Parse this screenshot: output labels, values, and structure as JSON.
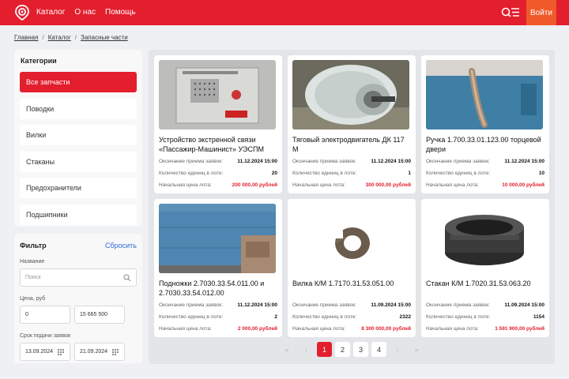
{
  "header": {
    "nav": [
      "Каталог",
      "О нас",
      "Помощь"
    ],
    "login_label": "Войти"
  },
  "breadcrumb": [
    "Главная",
    "Каталог",
    "Запасные части"
  ],
  "categories": {
    "title": "Категории",
    "items": [
      "Все запчасти",
      "Поводки",
      "Вилки",
      "Стаканы",
      "Предохранители",
      "Подшипники"
    ]
  },
  "filter": {
    "title": "Фильтр",
    "reset": "Сбросить",
    "name_label": "Название",
    "search_placeholder": "Поиск",
    "price_label": "Цена, руб",
    "price_from": "0",
    "price_to": "15 665 500",
    "deadline_label": "Срок подачи заявок",
    "date_from": "13.09.2024",
    "date_to": "21.09.2024"
  },
  "labels": {
    "deadline": "Окончание приема заявок:",
    "quantity": "Количество единиц в лоте:",
    "price": "Начальная цена лота:"
  },
  "products": [
    {
      "title": "Устройство экстренной связи «Пассажир-Машинист» УЭСПМ",
      "deadline": "11.12.2024 15:00",
      "quantity": "20",
      "price": "200 000,00 рублей"
    },
    {
      "title": "Тяговый электродвигатель ДК 117 М",
      "deadline": "11.12.2024 15:00",
      "quantity": "1",
      "price": "300 000,00 рублей"
    },
    {
      "title": "Ручка 1.700.33.01.123.00 торцевой двери",
      "deadline": "11.12.2024 15:00",
      "quantity": "10",
      "price": "10 000,00 рублей"
    },
    {
      "title": "Подножки 2.7030.33.54.011.00 и 2.7030.33.54.012.00",
      "deadline": "11.12.2024 15:00",
      "quantity": "2",
      "price": "2 000,00 рублей"
    },
    {
      "title": "Вилка К/М 1.7170.31.53.051.00",
      "deadline": "11.09.2024 15:00",
      "quantity": "2322",
      "price": "8 300 000,00 рублей"
    },
    {
      "title": "Стакан К/М 1.7020.31.53.063.20",
      "deadline": "11.09.2024 15:00",
      "quantity": "1154",
      "price": "1 591 900,00 рублей"
    }
  ],
  "pagination": {
    "pages": [
      "1",
      "2",
      "3",
      "4"
    ],
    "current": "1",
    "first": "«",
    "prev": "‹",
    "next": "›",
    "last": "»"
  },
  "colors": {
    "brand": "#e31e2d",
    "login": "#f05a2a",
    "link": "#2f6bd8"
  }
}
